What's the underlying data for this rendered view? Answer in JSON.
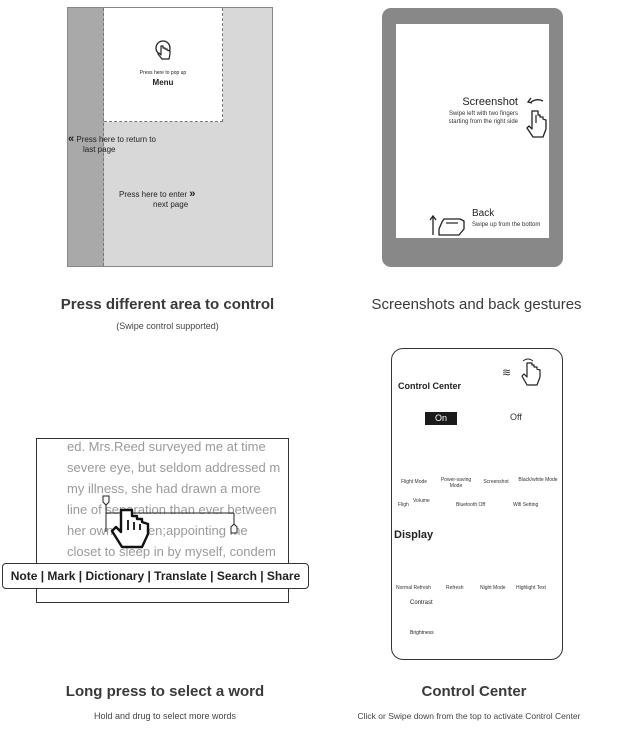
{
  "panel1": {
    "menu_hint": "Press here to pop up",
    "menu_label": "Menu",
    "return_line1": "Press here to return to",
    "return_line2": "last page",
    "enter_line1": "Press here to enter",
    "enter_line2": "next page",
    "caption_title": "Press different area to control",
    "caption_sub": "(Swipe control supported)"
  },
  "panel2": {
    "screenshot_label": "Screenshot",
    "screenshot_line1": "Swipe left with two fingers",
    "screenshot_line2": "starting from the right side",
    "back_label": "Back",
    "back_hint": "Swipe up from the bottom",
    "caption_title": "Screenshots and back gestures"
  },
  "panel3": {
    "lines": [
      "ed. Mrs.Reed surveyed me at time",
      "severe eye, but seldom addressed m",
      "my illness, she had drawn a more",
      "line of separation than ever between",
      "her own children;appointing me",
      "closet to sleep in by myself, condem"
    ],
    "toolbar": "Note | Mark | Dictionary | Translate | Search | Share",
    "caption_title": "Long press to select a word",
    "caption_sub": "Hold and drug to select more words"
  },
  "panel4": {
    "title": "Control Center",
    "on": "On",
    "off": "Off",
    "row1": [
      "Flight Mode",
      "Power-saving Mode",
      "Screenshot",
      "Black/white Mode"
    ],
    "row2_volume": "Volume",
    "row2_flight": "Fligh",
    "row2_bt": "Bluetooth Off",
    "row2_wifi": "Wifi Setting",
    "display": "Display",
    "row3": [
      "Normal Refresh",
      "Refresh",
      "Night Mode",
      "Highlight Text"
    ],
    "contrast": "Contrast",
    "brightness": "Brightness",
    "caption_title": "Control Center",
    "caption_sub": "Click or Swipe down from the top to activate Control Center"
  },
  "colors": {
    "screen_gray": "#888888",
    "strip": "#a9a9a9",
    "bg_panel": "#d8d8d8"
  }
}
